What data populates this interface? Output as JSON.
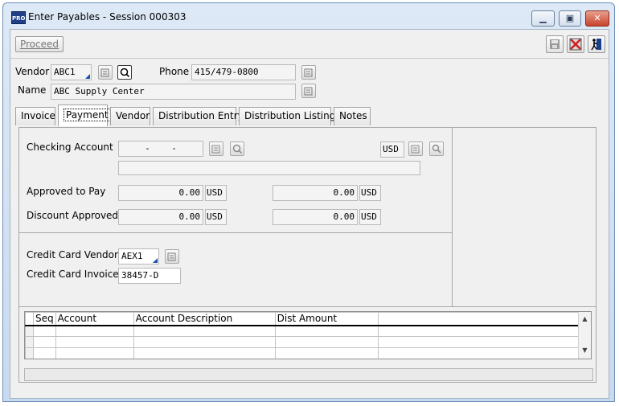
{
  "window": {
    "title": "Enter Payables - Session 000303",
    "app_icon_text": "PRO"
  },
  "toolbar": {
    "proceed_label": "Proceed",
    "icons": [
      "save-icon",
      "delete-icon",
      "exit-icon"
    ]
  },
  "header": {
    "vendor_label": "Vendor",
    "vendor_value": "ABC1",
    "phone_label": "Phone",
    "phone_value": "415/479-0800",
    "name_label": "Name",
    "name_value": "ABC Supply Center"
  },
  "tabs": [
    "Invoice",
    "Payment",
    "Vendor",
    "Distribution Entry",
    "Distribution Listing",
    "Notes"
  ],
  "active_tab": "Payment",
  "payment": {
    "checking_account_label": "Checking Account",
    "checking_account_value": "-    -",
    "currency_code": "USD",
    "checking_desc": "",
    "approved_to_pay_label": "Approved to Pay",
    "approved_to_pay_value": "0.00",
    "approved_to_pay_value2": "0.00",
    "discount_approved_label": "Discount Approved",
    "discount_approved_value": "0.00",
    "discount_approved_value2": "0.00",
    "credit_card_vendor_label": "Credit Card Vendor",
    "credit_card_vendor_value": "AEX1",
    "credit_card_invoice_label": "Credit Card Invoice",
    "credit_card_invoice_value": "38457-D"
  },
  "grid": {
    "columns": [
      "Seq",
      "Account",
      "Account Description",
      "Dist Amount",
      ""
    ],
    "rows": [
      [
        "",
        "",
        "",
        "",
        ""
      ],
      [
        "",
        "",
        "",
        "",
        ""
      ],
      [
        "",
        "",
        "",
        "",
        ""
      ]
    ]
  },
  "colors": {
    "title_bar": "#c9daee",
    "close_button": "#c8432c",
    "dropdown_marker": "#1a4fb0"
  }
}
